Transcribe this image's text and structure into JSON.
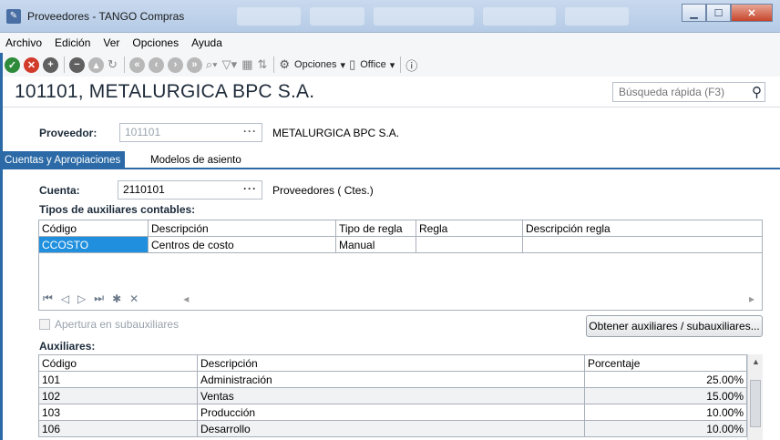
{
  "window": {
    "title": "Proveedores - TANGO Compras",
    "controls": [
      "minimize",
      "maximize",
      "close"
    ]
  },
  "menu": [
    "Archivo",
    "Edición",
    "Ver",
    "Opciones",
    "Ayuda"
  ],
  "toolbar": {
    "opciones_label": "Opciones",
    "office_label": "Office"
  },
  "header": {
    "title": "101101, METALURGICA BPC S.A.",
    "search_placeholder": "Búsqueda rápida (F3)"
  },
  "proveedor": {
    "label": "Proveedor:",
    "code": "101101",
    "name": "METALURGICA BPC S.A."
  },
  "tabs": [
    "Cuentas y Apropiaciones",
    "Modelos de asiento"
  ],
  "cuenta": {
    "label": "Cuenta:",
    "code": "2110101",
    "name": "Proveedores ( Ctes.)"
  },
  "tipos_aux": {
    "title": "Tipos de auxiliares contables:",
    "columns": [
      "Código",
      "Descripción",
      "Tipo de regla",
      "Regla",
      "Descripción regla"
    ],
    "rows": [
      [
        "CCOSTO",
        "Centros de costo",
        "Manual",
        "",
        ""
      ]
    ]
  },
  "navigator": [
    "⏮",
    "◁",
    "▷",
    "⏭",
    "✱",
    "✕"
  ],
  "apertura_label": "Apertura en subauxiliares",
  "obtener_button": "Obtener auxiliares / subauxiliares...",
  "auxiliares": {
    "title": "Auxiliares:",
    "columns": [
      "Código",
      "Descripción",
      "Porcentaje"
    ],
    "rows": [
      [
        "101",
        "Administración",
        "25.00%"
      ],
      [
        "102",
        "Ventas",
        "15.00%"
      ],
      [
        "103",
        "Producción",
        "10.00%"
      ],
      [
        "106",
        "Desarrollo",
        "10.00%"
      ]
    ]
  },
  "colors": {
    "accent": "#2b6aa6",
    "selection": "#1f8fde"
  }
}
